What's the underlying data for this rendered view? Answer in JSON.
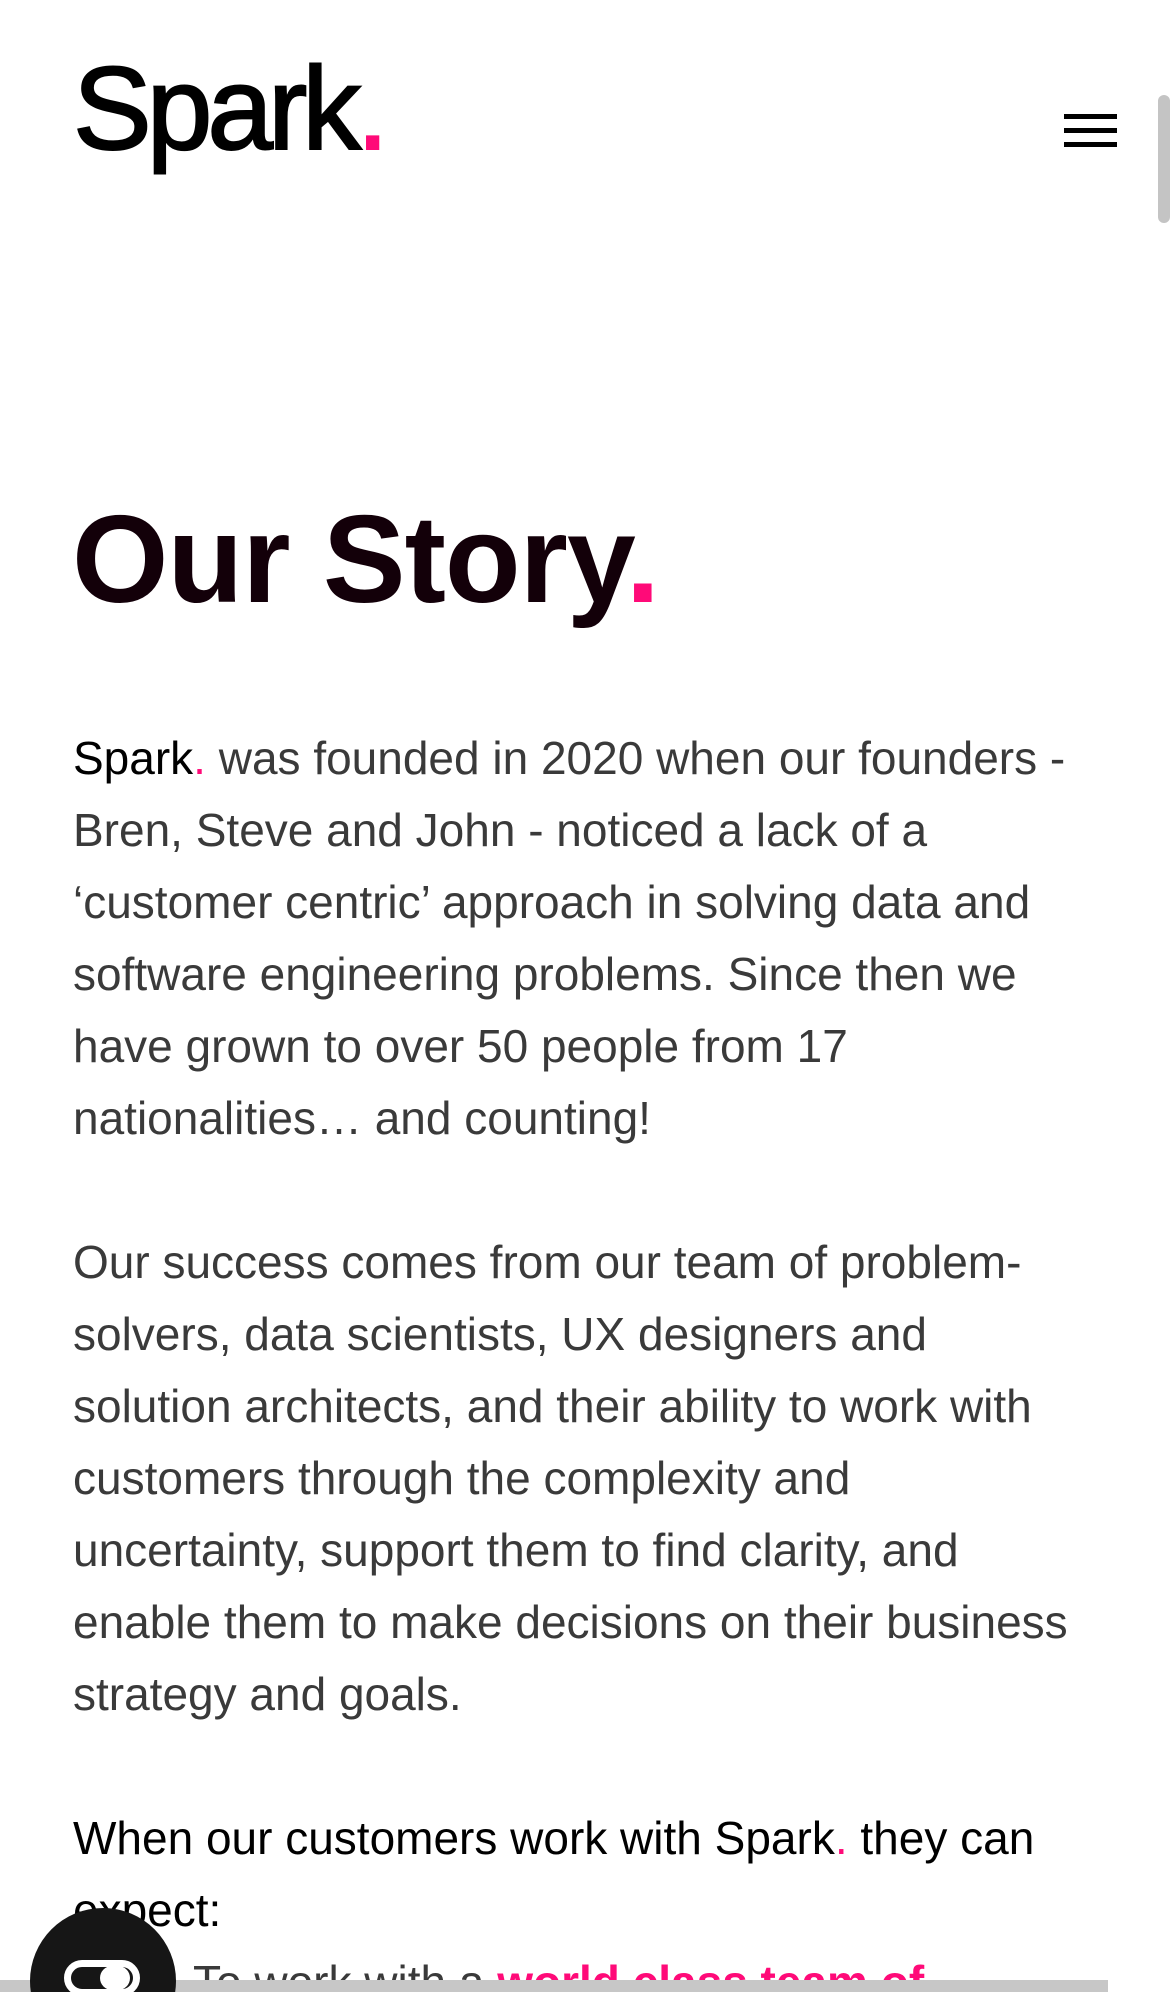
{
  "header": {
    "logo_text": "Spark",
    "logo_dot": ".",
    "menu_icon": "hamburger-menu-icon"
  },
  "main": {
    "title": "Our Story",
    "title_dot": ".",
    "paragraph1": {
      "brand": "Spark",
      "brand_dot": ".",
      "text": " was founded in 2020 when our founders - Bren, Steve and John - noticed a lack of a ‘customer centric’ approach in solving data and software engineering problems. Since then we have grown to over 50 people from 17 nationalities… and counting!"
    },
    "paragraph2": "Our success comes from our team of problem-solvers, data scientists, UX designers and solution architects, and their ability to work with customers through the complexity and uncertainty, support them to find clarity, and enable them to make decisions on their business strategy and goals.",
    "paragraph3": {
      "text_before": "When our customers work with ",
      "brand": "Spark",
      "brand_dot": ".",
      "text_after": " they can expect:"
    },
    "list_items": [
      {
        "text": "To work with a ",
        "link_text": "world class team of"
      }
    ]
  },
  "widgets": {
    "toggle_icon": "toggle-switch-icon"
  },
  "colors": {
    "accent": "#ff0a78",
    "heading": "#130009",
    "body_text": "#3a3a3a"
  }
}
